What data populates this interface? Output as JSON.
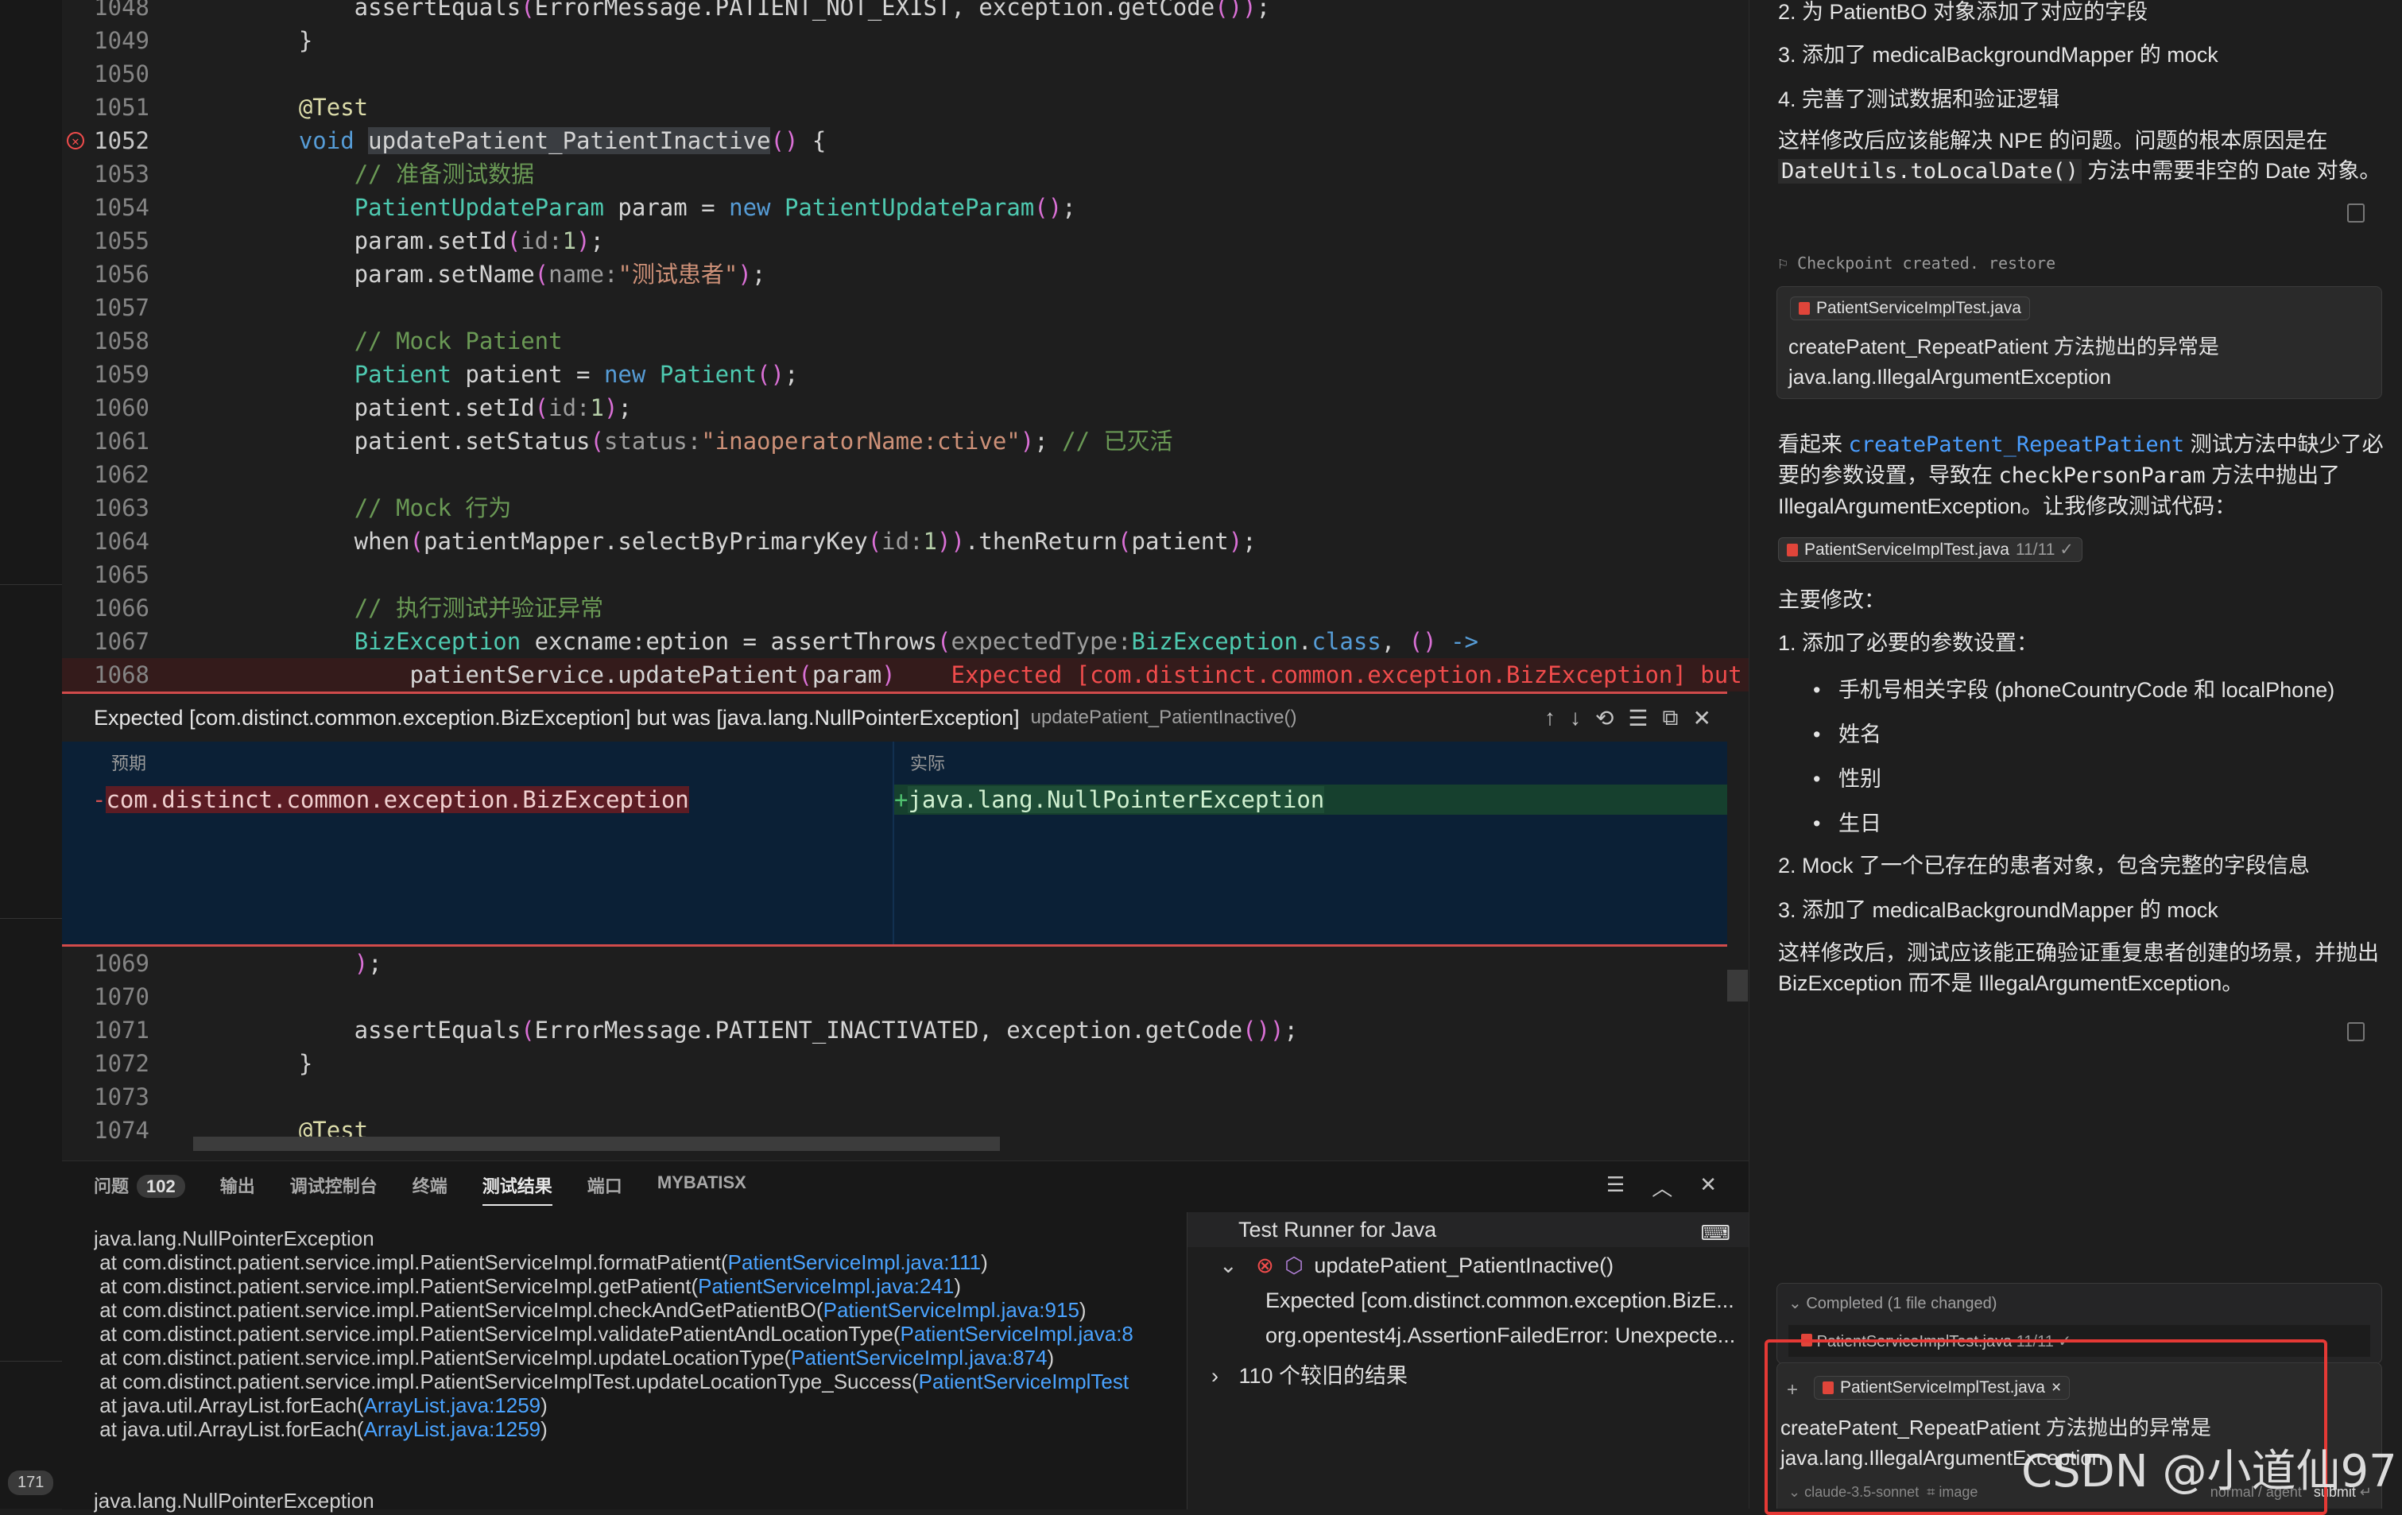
{
  "editor": {
    "lines": [
      {
        "n": "1048",
        "kind": "partial",
        "text": "assertEquals(ErrorMessage.PATIENT_NOT_EXIST, exception.getCode());"
      },
      {
        "n": "1049",
        "text": "}"
      },
      {
        "n": "1050",
        "text": ""
      },
      {
        "n": "1051",
        "text": "@Test"
      },
      {
        "n": "1052",
        "text": "void updatePatient_PatientInactive() {"
      },
      {
        "n": "1053",
        "text": "// 准备测试数据"
      },
      {
        "n": "1054",
        "text": "PatientUpdateParam param = new PatientUpdateParam();"
      },
      {
        "n": "1055",
        "text": "param.setId(id:1);"
      },
      {
        "n": "1056",
        "text": "param.setName(name:\"测试患者\");"
      },
      {
        "n": "1057",
        "text": ""
      },
      {
        "n": "1058",
        "text": "// Mock Patient"
      },
      {
        "n": "1059",
        "text": "Patient patient = new Patient();"
      },
      {
        "n": "1060",
        "text": "patient.setId(id:1);"
      },
      {
        "n": "1061",
        "text": "patient.setStatus(status:\"inaoperatorName:ctive\"); // 已灭活"
      },
      {
        "n": "1062",
        "text": ""
      },
      {
        "n": "1063",
        "text": "// Mock 行为"
      },
      {
        "n": "1064",
        "text": "when(patientMapper.selectByPrimaryKey(id:1)).thenReturn(patient);"
      },
      {
        "n": "1065",
        "text": ""
      },
      {
        "n": "1066",
        "text": "// 执行测试并验证异常"
      },
      {
        "n": "1067",
        "text": "BizException excname:eption = assertThrows(expectedType:BizException.class, () ->"
      },
      {
        "n": "1068",
        "text": "patientService.updatePatient(param)"
      },
      {
        "n": "1069",
        "text": ");"
      },
      {
        "n": "1070",
        "text": ""
      },
      {
        "n": "1071",
        "text": "assertEquals(ErrorMessage.PATIENT_INACTIVATED, exception.getCode());"
      },
      {
        "n": "1072",
        "text": "}"
      },
      {
        "n": "1073",
        "text": ""
      },
      {
        "n": "1074",
        "text": "@Test"
      }
    ],
    "inline_error": "Expected [com.distinct.common.exception.BizException] but was [ja",
    "peek": {
      "title": "Expected [com.distinct.common.exception.BizException] but was [java.lang.NullPointerException]",
      "subtitle": "updatePatient_PatientInactive()",
      "expected_label": "预期",
      "actual_label": "实际",
      "expected_value": "com.distinct.common.exception.BizException",
      "actual_value": "java.lang.NullPointerException"
    }
  },
  "panel": {
    "tabs": [
      "问题",
      "输出",
      "调试控制台",
      "终端",
      "测试结果",
      "端口",
      "MYBATISX"
    ],
    "problems_count": "102",
    "trace": [
      {
        "pre": "java.lang.NullPointerException",
        "link": "",
        "post": ""
      },
      {
        "pre": " at com.distinct.patient.service.impl.PatientServiceImpl.formatPatient(",
        "link": "PatientServiceImpl.java:111",
        "post": ")"
      },
      {
        "pre": " at com.distinct.patient.service.impl.PatientServiceImpl.getPatient(",
        "link": "PatientServiceImpl.java:241",
        "post": ")"
      },
      {
        "pre": " at com.distinct.patient.service.impl.PatientServiceImpl.checkAndGetPatientBO(",
        "link": "PatientServiceImpl.java:915",
        "post": ")"
      },
      {
        "pre": " at com.distinct.patient.service.impl.PatientServiceImpl.validatePatientAndLocationType(",
        "link": "PatientServiceImpl.java:8",
        "post": ""
      },
      {
        "pre": " at com.distinct.patient.service.impl.PatientServiceImpl.updateLocationType(",
        "link": "PatientServiceImpl.java:874",
        "post": ")"
      },
      {
        "pre": " at com.distinct.patient.service.impl.PatientServiceImplTest.updateLocationType_Success(",
        "link": "PatientServiceImplTest",
        "post": ""
      },
      {
        "pre": " at java.util.ArrayList.forEach(",
        "link": "ArrayList.java:1259",
        "post": ")"
      },
      {
        "pre": " at java.util.ArrayList.forEach(",
        "link": "ArrayList.java:1259",
        "post": ")"
      },
      {
        "pre": "",
        "link": "",
        "post": ""
      },
      {
        "pre": "",
        "link": "",
        "post": ""
      },
      {
        "pre": "java.lang.NullPointerException",
        "link": "",
        "post": ""
      }
    ],
    "runner": {
      "title": "Test Runner for Java",
      "test_name": "updatePatient_PatientInactive()",
      "detail1": "Expected [com.distinct.common.exception.BizE...",
      "detail2": "org.opentest4j.AssertionFailedError: Unexpecte...",
      "older": "110 个较旧的结果"
    }
  },
  "activity": {
    "badge": "171"
  },
  "chat": {
    "top_items": [
      "2. 为 PatientBO 对象添加了对应的字段",
      "3. 添加了 medicalBackgroundMapper 的 mock",
      "4. 完善了测试数据和验证逻辑"
    ],
    "summary_pre": "这样修改后应该能解决 NPE 的问题。问题的根本原因是在",
    "summary_code": "DateUtils.toLocalDate()",
    "summary_post": " 方法中需要非空的 Date 对象。",
    "checkpoint": "Checkpoint created.",
    "restore": "restore",
    "prompt_file": "PatientServiceImplTest.java",
    "prompt_text1": "createPatent_RepeatPatient  方法抛出的异常是",
    "prompt_text2": "java.lang.IllegalArgumentException",
    "reply_pre": "看起来 ",
    "reply_code": "createPatent_RepeatPatient",
    "reply_mid": " 测试方法中缺少了必",
    "reply_line2_pre": "要的参数设置，导致在 ",
    "reply_line2_code": "checkPersonParam",
    "reply_line2_post": " 方法中抛出了",
    "reply_line3": "IllegalArgumentException。让我修改测试代码：",
    "edit_chip": "PatientServiceImplTest.java",
    "edit_chip_count": "11/11 ✓",
    "main_changes": "主要修改：",
    "change1": "1. 添加了必要的参数设置：",
    "bullets": [
      "手机号相关字段 (phoneCountryCode 和 localPhone)",
      "姓名",
      "性别",
      "生日"
    ],
    "change2": "2. Mock 了一个已存在的患者对象，包含完整的字段信息",
    "change3": "3. 添加了 medicalBackgroundMapper 的 mock",
    "closing1": "这样修改后，测试应该能正确验证重复患者创建的场景，并抛出",
    "closing2": "BizException 而不是 IllegalArgumentException。",
    "completed": "Completed (1 file changed)",
    "completed_file": "PatientServiceImplTest.java",
    "completed_count": "11/11 ✓",
    "input_file": "PatientServiceImplTest.java",
    "input_text1": "createPatent_RepeatPatient  方法抛出的异常是",
    "input_text2": "java.lang.IllegalArgumentException",
    "model": "claude-3.5-sonnet",
    "image_label": "image",
    "mode": "normal / agent",
    "submit": "submit"
  },
  "watermark": "CSDN @小道仙97"
}
